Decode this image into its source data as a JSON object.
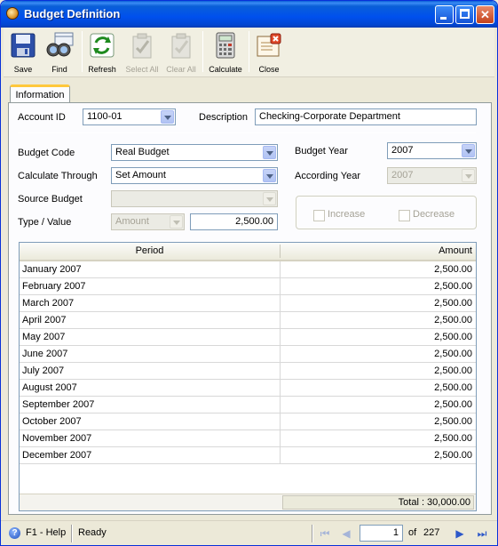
{
  "window": {
    "title": "Budget Definition"
  },
  "toolbar": {
    "save": "Save",
    "find": "Find",
    "refresh": "Refresh",
    "select_all": "Select All",
    "clear_all": "Clear All",
    "calculate": "Calculate",
    "close": "Close"
  },
  "tabs": {
    "information": "Information"
  },
  "form": {
    "account_id_label": "Account ID",
    "account_id_value": "1100-01",
    "description_label": "Description",
    "description_value": "Checking-Corporate Department",
    "budget_code_label": "Budget Code",
    "budget_code_value": "Real Budget",
    "calculate_through_label": "Calculate Through",
    "calculate_through_value": "Set Amount",
    "source_budget_label": "Source Budget",
    "source_budget_value": "",
    "type_value_label": "Type / Value",
    "type_value_type": "Amount",
    "type_value_amount": "2,500.00",
    "budget_year_label": "Budget Year",
    "budget_year_value": "2007",
    "according_year_label": "According Year",
    "according_year_value": "2007",
    "increase_label": "Increase",
    "decrease_label": "Decrease"
  },
  "grid": {
    "col_period": "Period",
    "col_amount": "Amount",
    "rows": [
      {
        "period": "January 2007",
        "amount": "2,500.00"
      },
      {
        "period": "February 2007",
        "amount": "2,500.00"
      },
      {
        "period": "March 2007",
        "amount": "2,500.00"
      },
      {
        "period": "April 2007",
        "amount": "2,500.00"
      },
      {
        "period": "May 2007",
        "amount": "2,500.00"
      },
      {
        "period": "June 2007",
        "amount": "2,500.00"
      },
      {
        "period": "July 2007",
        "amount": "2,500.00"
      },
      {
        "period": "August 2007",
        "amount": "2,500.00"
      },
      {
        "period": "September 2007",
        "amount": "2,500.00"
      },
      {
        "period": "October 2007",
        "amount": "2,500.00"
      },
      {
        "period": "November 2007",
        "amount": "2,500.00"
      },
      {
        "period": "December 2007",
        "amount": "2,500.00"
      }
    ],
    "total": "Total : 30,000.00"
  },
  "status": {
    "help": "F1 - Help",
    "state": "Ready",
    "page": "1",
    "of": "of",
    "total_pages": "227"
  }
}
